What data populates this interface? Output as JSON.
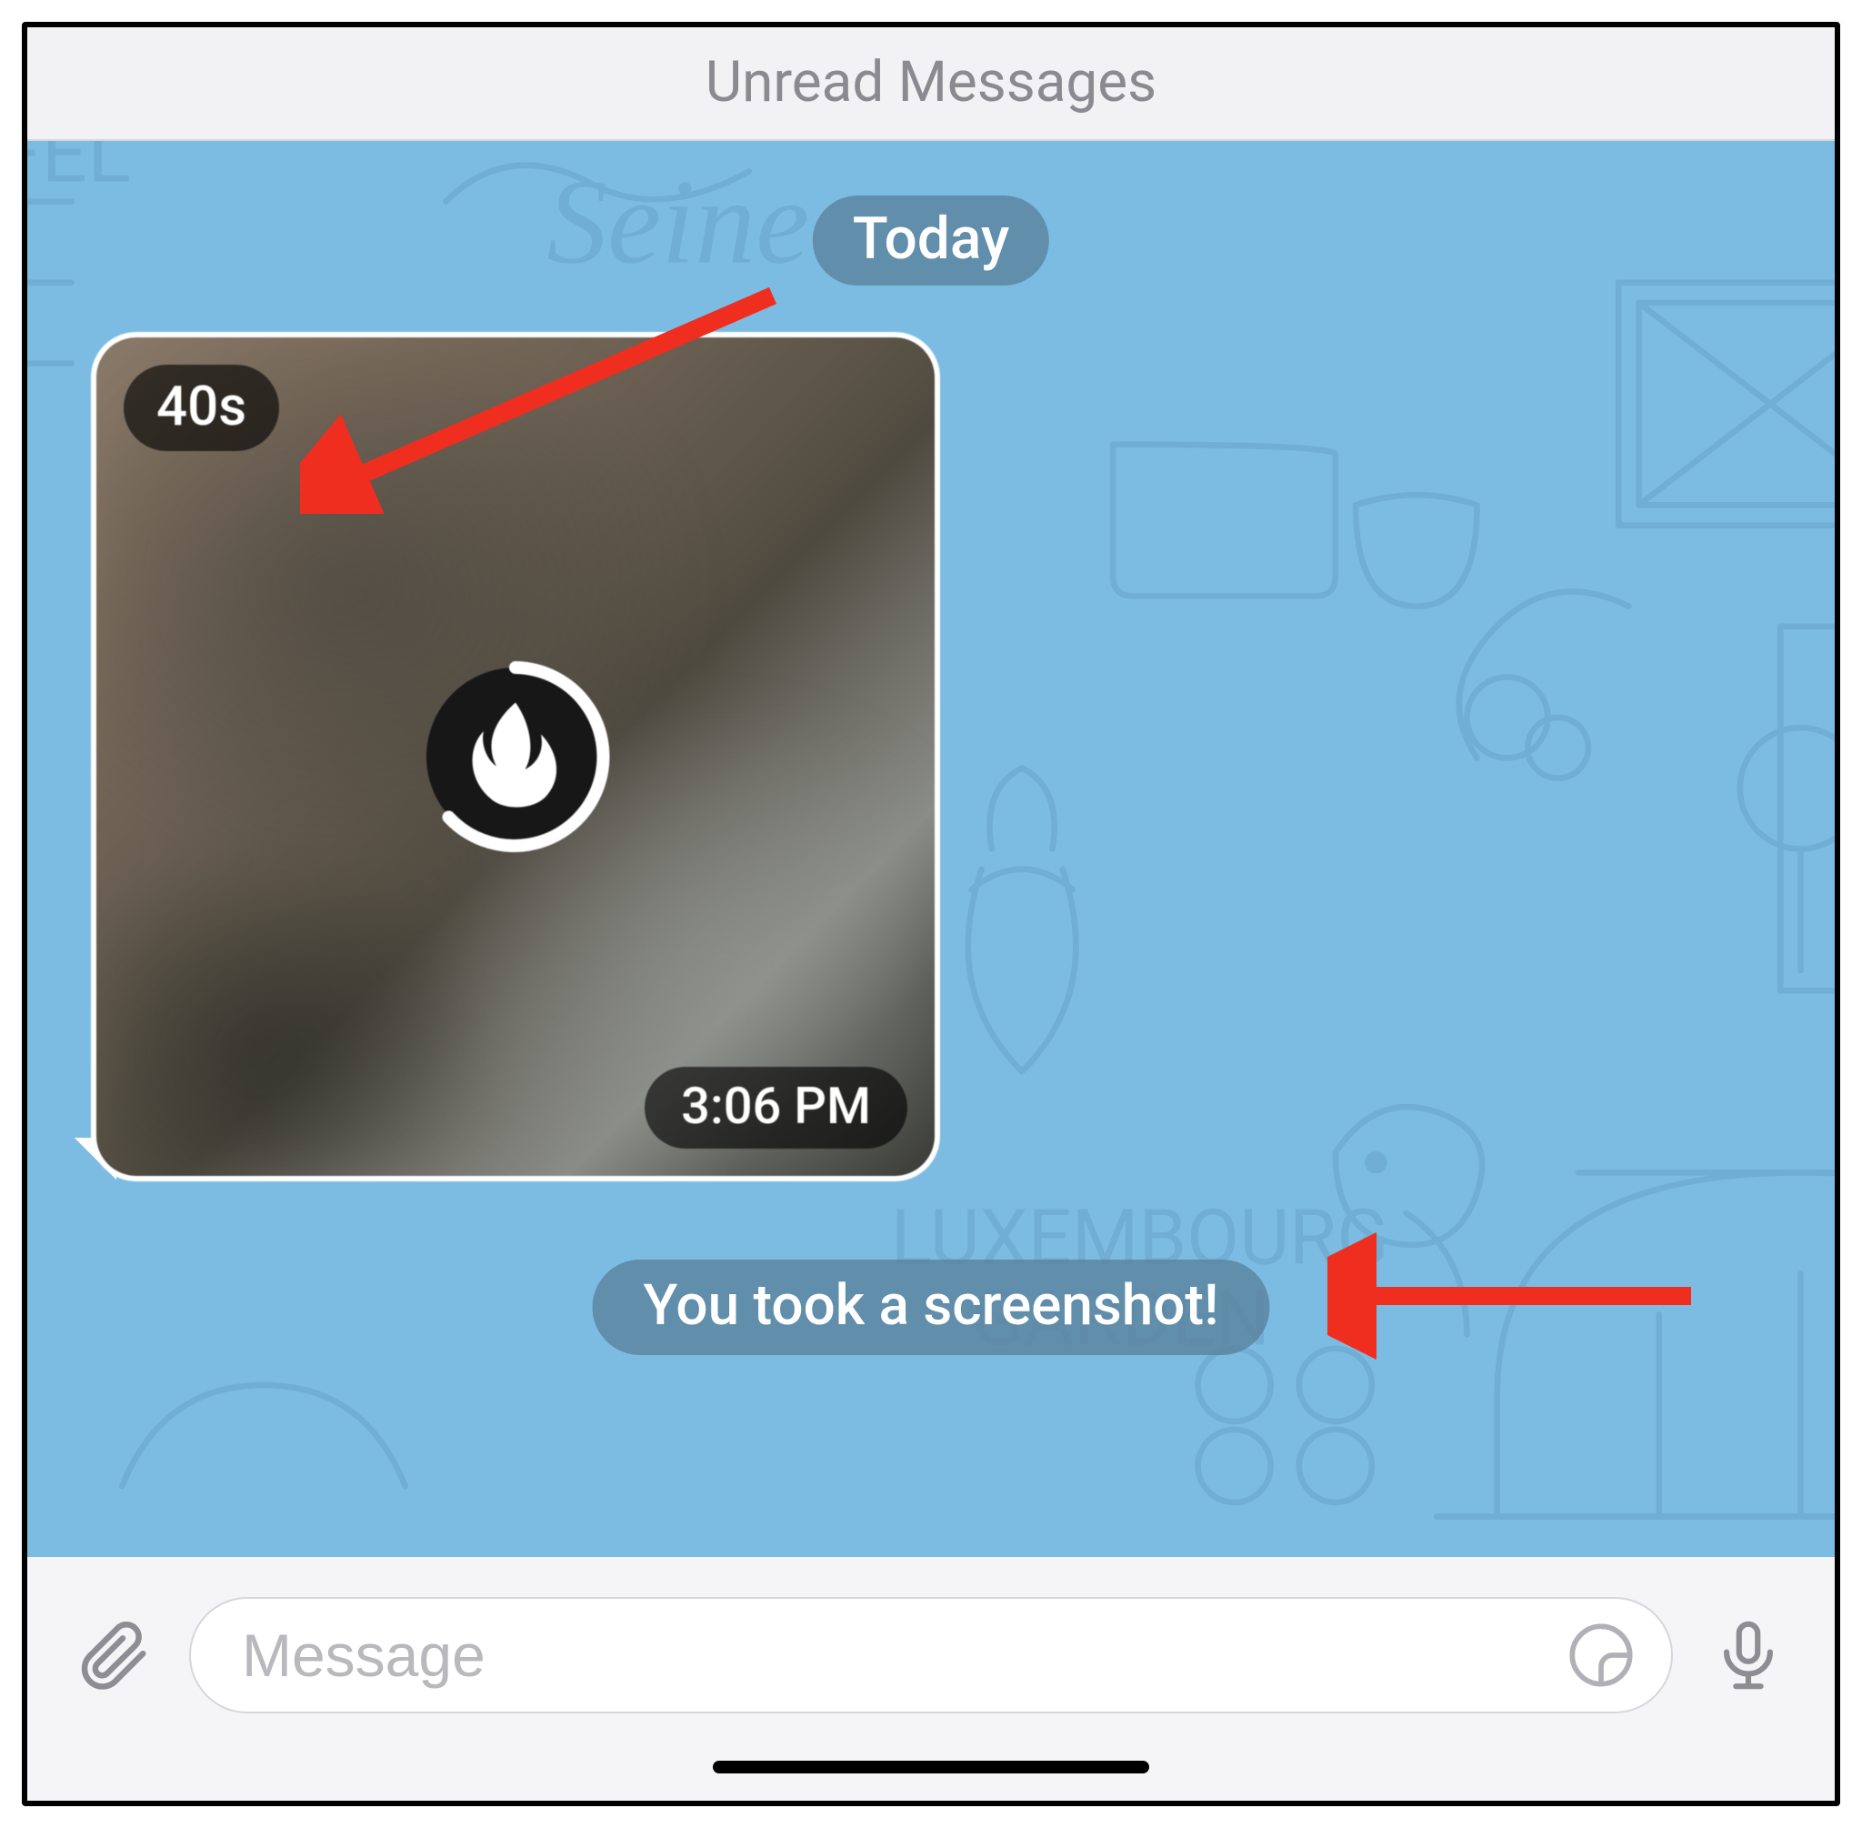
{
  "header": {
    "title": "Unread Messages"
  },
  "chat": {
    "date_label": "Today",
    "message": {
      "timer_badge": "40s",
      "timestamp": "3:06 PM",
      "icon": "flame-icon"
    },
    "service_notice": "You took a screenshot!"
  },
  "composer": {
    "placeholder": "Message",
    "attach_icon": "paperclip-icon",
    "sticker_icon": "sticker-icon",
    "mic_icon": "microphone-icon"
  },
  "annotations": {
    "arrow1_target": "timer-badge",
    "arrow2_target": "service-notice"
  },
  "colors": {
    "chat_bg": "#7cbce3",
    "pill_bg": "rgba(90,130,155,0.78)",
    "arrow": "#ef2e1f"
  }
}
